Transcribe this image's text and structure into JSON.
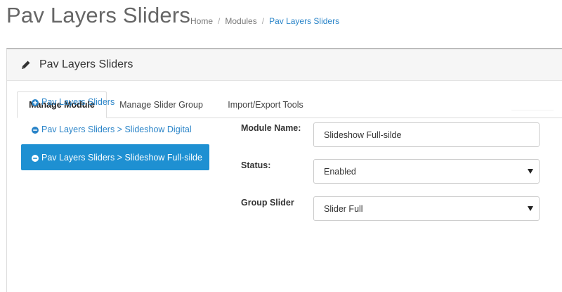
{
  "page": {
    "title": "Pav Layers Sliders"
  },
  "breadcrumb": [
    {
      "label": "Home"
    },
    {
      "label": "Modules"
    },
    {
      "label": "Pav Layers Sliders"
    }
  ],
  "panel": {
    "title": "Pav Layers Sliders",
    "icon": "pencil-icon"
  },
  "tabs": [
    {
      "label": "Manage Module",
      "active": true
    },
    {
      "label": "Manage Slider Group",
      "active": false
    },
    {
      "label": "Import/Export Tools",
      "active": false
    }
  ],
  "modules": [
    {
      "label": "Pav Layers Sliders",
      "icon": "plus-circle-icon"
    },
    {
      "label": "Pav Layers Sliders > Slideshow Digital",
      "icon": "minus-circle-icon"
    },
    {
      "label": "Pav Layers Sliders > Slideshow Full-silde",
      "icon": "minus-circle-icon",
      "active": true
    }
  ],
  "form": {
    "module_name_label": "Module Name:",
    "module_name_value": "Slideshow Full-silde",
    "status_label": "Status:",
    "status_value": "Enabled",
    "group_label": "Group Slider",
    "group_value": "Slider Full"
  },
  "colors": {
    "accent": "#1e90d2",
    "link": "#2a84c8"
  }
}
